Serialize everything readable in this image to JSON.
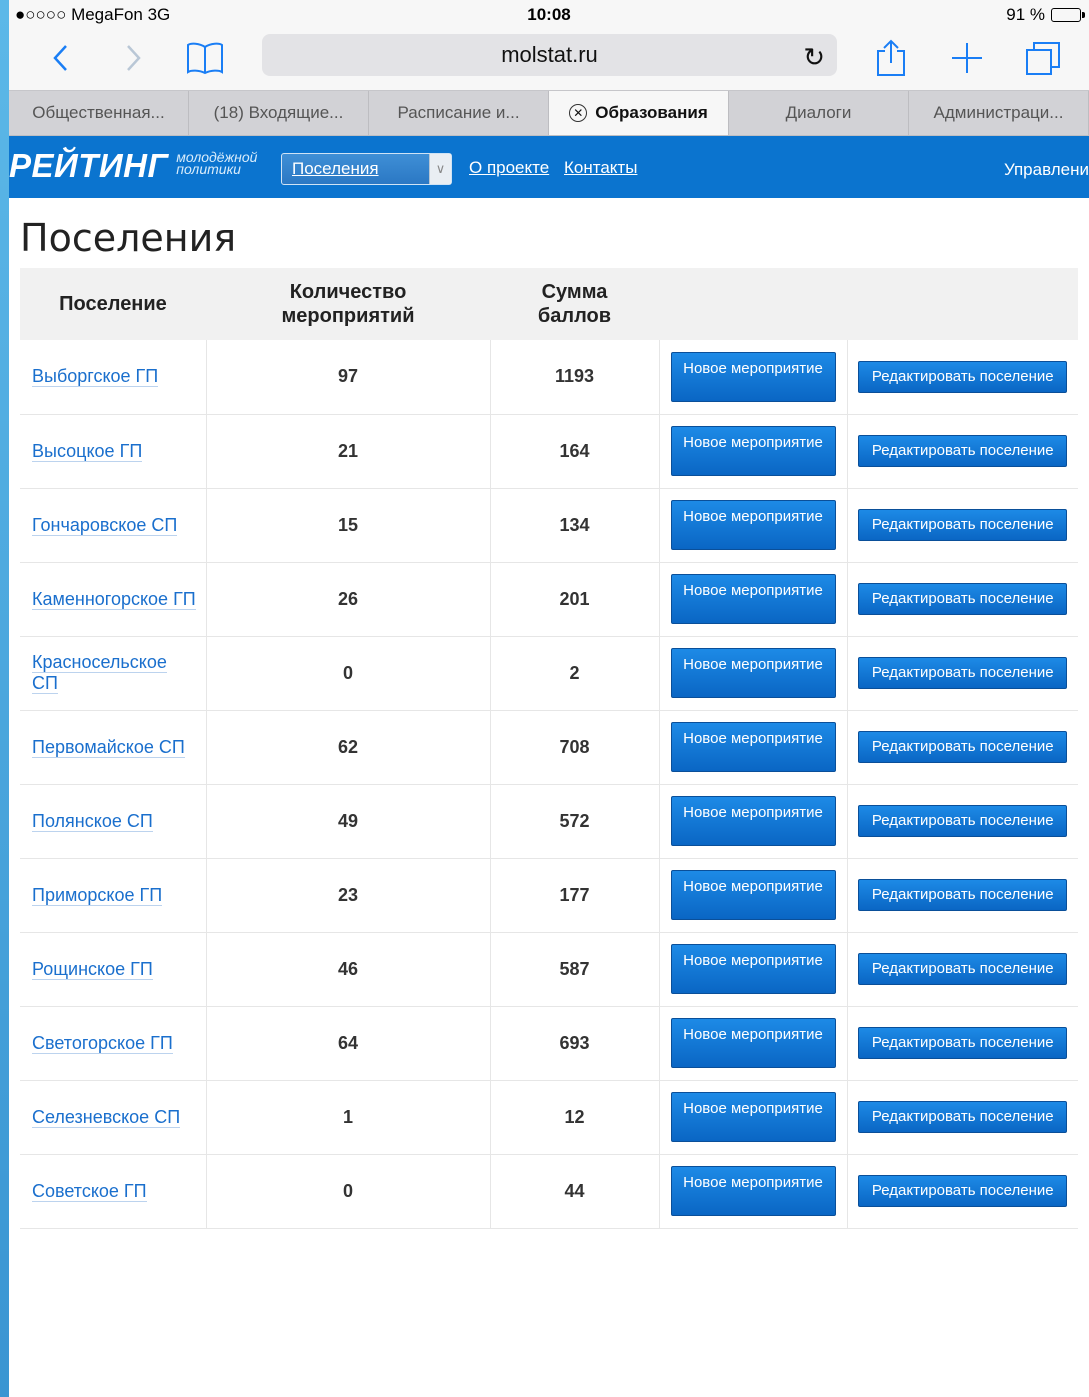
{
  "statusbar": {
    "carrier": "●○○○○ MegaFon  3G",
    "time": "10:08",
    "battery": "91 %"
  },
  "browser": {
    "address": "molstat.ru",
    "reload_icon": "reload-icon",
    "tabs": [
      {
        "label": "Общественная..."
      },
      {
        "label": "(18) Входящие..."
      },
      {
        "label": "Расписание и..."
      },
      {
        "label": "Образования",
        "active": true
      },
      {
        "label": "Диалоги"
      },
      {
        "label": "Администраци..."
      }
    ]
  },
  "site": {
    "logo_main": "РЕЙТИНГ",
    "logo_sub_line1": "молодёжной",
    "logo_sub_line2": "политики",
    "select_value": "Поселения",
    "nav_about": "О проекте",
    "nav_contacts": "Контакты",
    "nav_manage": "Управлени",
    "accent_color": "#0b74cf"
  },
  "page": {
    "title": "Поселения",
    "table": {
      "headers": {
        "name": "Поселение",
        "count": "Количество мероприятий",
        "sum": "Сумма баллов"
      },
      "new_event_label": "Новое мероприятие",
      "edit_label": "Редактировать поселение",
      "rows": [
        {
          "name": "Выборгское ГП",
          "count": "97",
          "sum": "1193"
        },
        {
          "name": "Высоцкое ГП",
          "count": "21",
          "sum": "164"
        },
        {
          "name": "Гончаровское СП",
          "count": "15",
          "sum": "134"
        },
        {
          "name": "Каменногорское ГП",
          "count": "26",
          "sum": "201"
        },
        {
          "name": "Красносельское СП",
          "count": "0",
          "sum": "2"
        },
        {
          "name": "Первомайское СП",
          "count": "62",
          "sum": "708"
        },
        {
          "name": "Полянское СП",
          "count": "49",
          "sum": "572"
        },
        {
          "name": "Приморское ГП",
          "count": "23",
          "sum": "177"
        },
        {
          "name": "Рощинское ГП",
          "count": "46",
          "sum": "587"
        },
        {
          "name": "Светогорское ГП",
          "count": "64",
          "sum": "693"
        },
        {
          "name": "Селезневское СП",
          "count": "1",
          "sum": "12"
        },
        {
          "name": "Советское ГП",
          "count": "0",
          "sum": "44"
        }
      ]
    }
  }
}
